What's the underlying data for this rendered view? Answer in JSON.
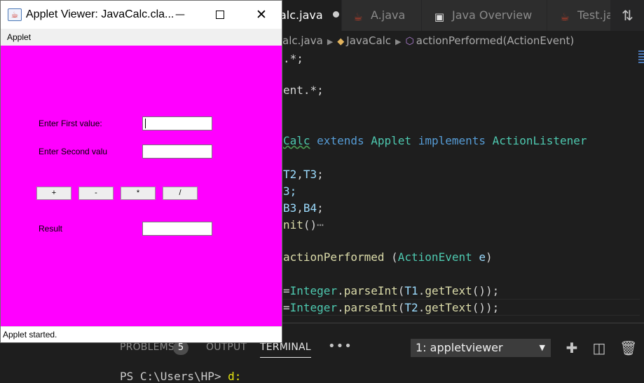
{
  "editor": {
    "tabs": [
      {
        "label": "alc.java",
        "active": true,
        "modified": true
      },
      {
        "label": "A.java"
      },
      {
        "label": "Java Overview"
      },
      {
        "label": "Test.java"
      }
    ],
    "breadcrumb": [
      "alc.java",
      "JavaCalc",
      "actionPerformed(ActionEvent)"
    ],
    "code": {
      "l1": ".*;",
      "l2": "ent.*;",
      "l3": {
        "a": "Calc",
        "b": "extends",
        "c": "Applet",
        "d": "implements",
        "e": "ActionListener"
      },
      "l4": {
        "a": "T2",
        "b": ",",
        "c": "T3",
        "d": ";"
      },
      "l5": "3;",
      "l6": {
        "a": "B3",
        "b": ",",
        "c": "B4",
        "d": ";"
      },
      "l7": {
        "a": "nit",
        "b": "()",
        "c": "⋯"
      },
      "l8": {
        "a": "actionPerformed",
        "b": " (",
        "c": "ActionEvent",
        "d": " e",
        "e": ")"
      },
      "l9": {
        "a": "=",
        "b": "Integer",
        "c": ".",
        "d": "parseInt",
        "e": "(",
        "f": "T1",
        "g": ".",
        "h": "getText",
        "i": "());"
      },
      "l10": {
        "a": "=",
        "b": "Integer",
        "c": ".",
        "d": "parseInt",
        "e": "(",
        "f": "T2",
        "g": ".",
        "h": "getText",
        "i": "());"
      }
    }
  },
  "panel": {
    "tabs": [
      {
        "label": "PROBLEMS"
      },
      {
        "label": "OUTPUT"
      },
      {
        "label": "TERMINAL",
        "active": true
      }
    ],
    "problems_count": "5",
    "more": "•••",
    "terminal_select": "1: appletviewer",
    "prompt": "PS C:\\Users\\HP> ",
    "command": "d:"
  },
  "applet": {
    "title": "Applet Viewer: JavaCalc.cla...",
    "menu": "Applet",
    "label1": "Enter First value:",
    "label2": "Enter Second valu",
    "result_label": "Result",
    "field1": "",
    "field2": "",
    "result": "",
    "buttons": [
      "+",
      "-",
      "*",
      "/"
    ],
    "status": "Applet started.",
    "background": "#ff00ff"
  },
  "colors": {
    "keyword": "#569cd6",
    "type": "#4ec9b0",
    "function": "#dcdcaa",
    "variable": "#9cdcfe"
  }
}
